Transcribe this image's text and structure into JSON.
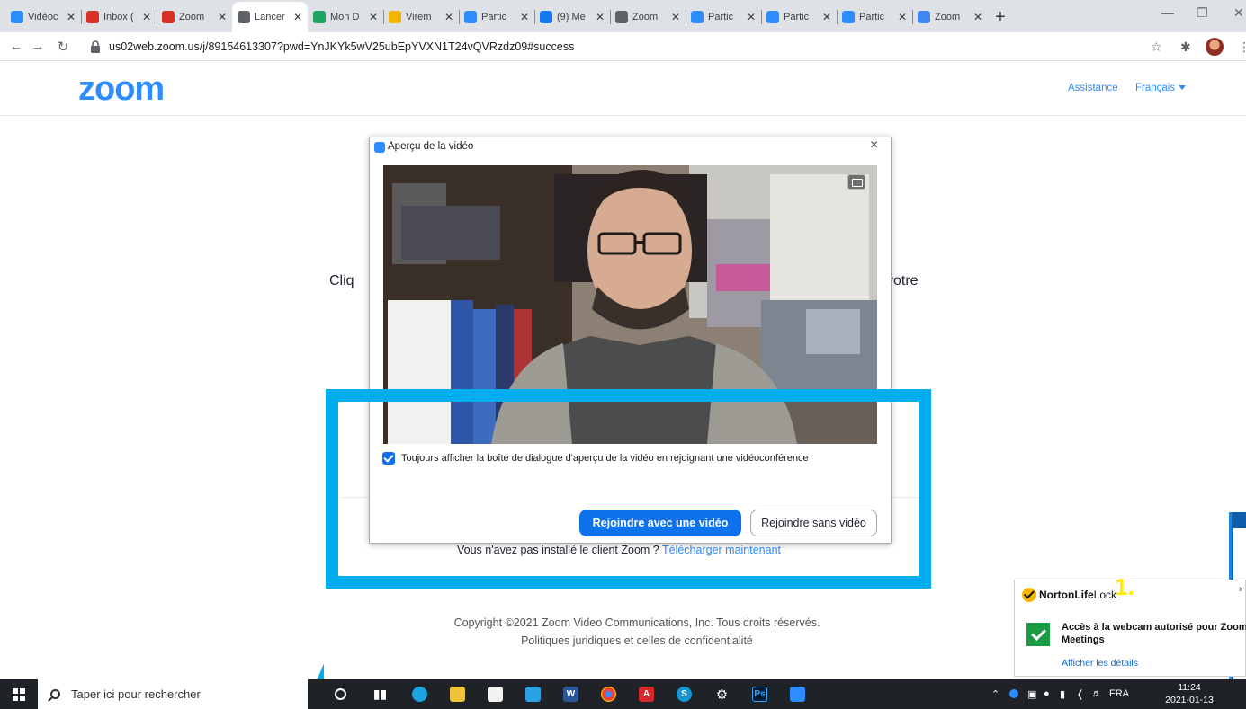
{
  "browser": {
    "tabs": [
      {
        "title": "Vidéoc",
        "icon": "zoom-icon",
        "color": "#2d8cff"
      },
      {
        "title": "Inbox (",
        "icon": "gmail-icon",
        "color": "#d93025"
      },
      {
        "title": "Zoom",
        "icon": "gmail-icon",
        "color": "#d93025"
      },
      {
        "title": "Lancer",
        "icon": "globe-icon",
        "color": "#5f6368",
        "active": true
      },
      {
        "title": "Mon D",
        "icon": "drive-icon",
        "color": "#1fa463"
      },
      {
        "title": "Virem",
        "icon": "slides-icon",
        "color": "#f4b400"
      },
      {
        "title": "Partic",
        "icon": "zoom-icon",
        "color": "#2d8cff"
      },
      {
        "title": "(9) Me",
        "icon": "facebook-icon",
        "color": "#1877f2"
      },
      {
        "title": "Zoom",
        "icon": "globe-icon",
        "color": "#5f6368"
      },
      {
        "title": "Partic",
        "icon": "zoom-icon",
        "color": "#2d8cff"
      },
      {
        "title": "Partic",
        "icon": "zoom-icon",
        "color": "#2d8cff"
      },
      {
        "title": "Partic",
        "icon": "zoom-icon",
        "color": "#2d8cff"
      },
      {
        "title": "Zoom",
        "icon": "google-icon",
        "color": "#4285f4"
      }
    ],
    "new_tab_label": "+",
    "url": "us02web.zoom.us/j/89154613307?pwd=YnJKYk5wV25ubEpYVXN1T24vQVRzdz09#success"
  },
  "zoom_page": {
    "logo": "zoom",
    "support_link": "Assistance",
    "language": "Français",
    "prompt_left": "Cliq",
    "prompt_right": "votre",
    "no_client_text": "Vous n'avez pas installé le client Zoom ?",
    "download_link": "Télécharger maintenant",
    "copyright": "Copyright ©2021 Zoom Video Communications, Inc. Tous droits réservés.",
    "legal": "Politiques juridiques et celles de confidentialité",
    "accent_color": "#2d8cff"
  },
  "dialog": {
    "title": "Aperçu de la vidéo",
    "checkbox_label": "Toujours afficher la boîte de dialogue d'aperçu de la vidéo en rejoignant une vidéoconférence",
    "checkbox_checked": true,
    "join_with_video": "Rejoindre avec une vidéo",
    "join_without_video": "Rejoindre sans vidéo",
    "primary_color": "#0e72ed"
  },
  "annotation": {
    "highlight_color": "#00aeef"
  },
  "norton": {
    "brand_bold": "NortonLife",
    "brand_light": "Lock",
    "step_number": "1.",
    "message": "Accès à la webcam autorisé pour Zoom Meetings",
    "details_link": "Afficher les détails"
  },
  "taskbar": {
    "search_placeholder": "Taper ici pour rechercher",
    "language": "FRA",
    "time": "11:24",
    "date": "2021-01-13"
  }
}
